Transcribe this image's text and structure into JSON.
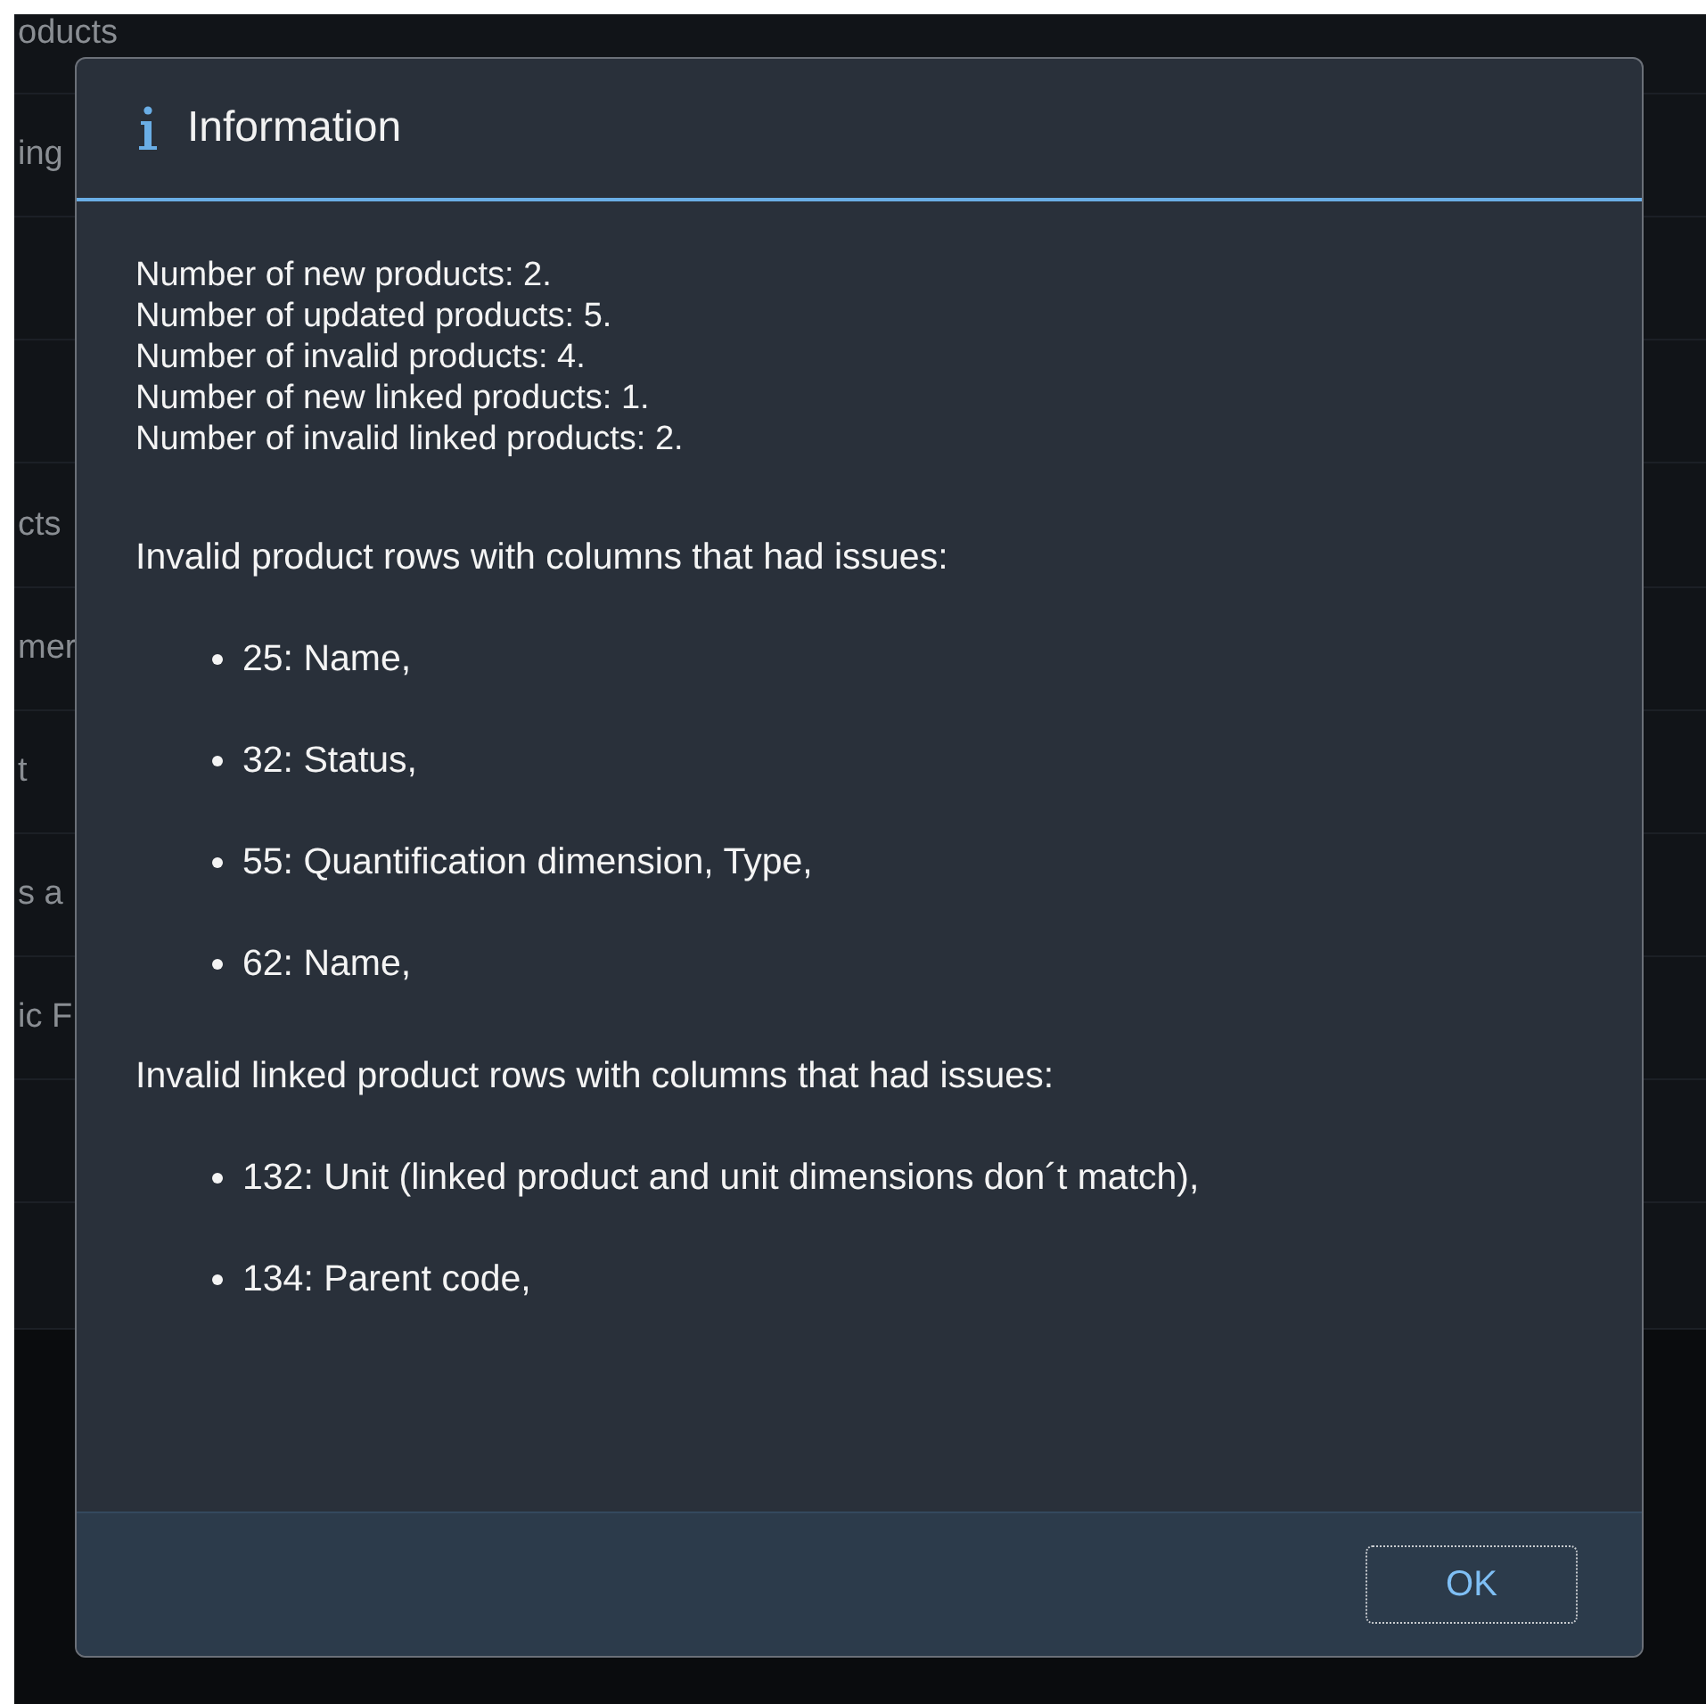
{
  "background_list": {
    "rows": [
      {
        "label": "oducts"
      },
      {
        "label": "ing"
      },
      {},
      {},
      {
        "label": "cts"
      },
      {
        "label": "mer"
      },
      {
        "label": "t"
      },
      {
        "label": "s a"
      },
      {
        "label": "ic F"
      },
      {},
      {}
    ]
  },
  "dialog": {
    "title": "Information",
    "summary": [
      "Number of new products: 2.",
      "Number of updated products: 5.",
      "Number of invalid products: 4.",
      "Number of new linked products: 1.",
      "Number of invalid linked products: 2."
    ],
    "sections": [
      {
        "heading": "Invalid product rows with columns that had issues:",
        "items": [
          "25: Name,",
          "32: Status,",
          "55: Quantification dimension, Type,",
          "62: Name,"
        ]
      },
      {
        "heading": "Invalid linked product rows with columns that had issues:",
        "items": [
          "132: Unit (linked product and unit dimensions don´t match),",
          "134: Parent code,"
        ]
      }
    ],
    "buttons": [
      {
        "label": "OK",
        "focused": true
      }
    ]
  }
}
